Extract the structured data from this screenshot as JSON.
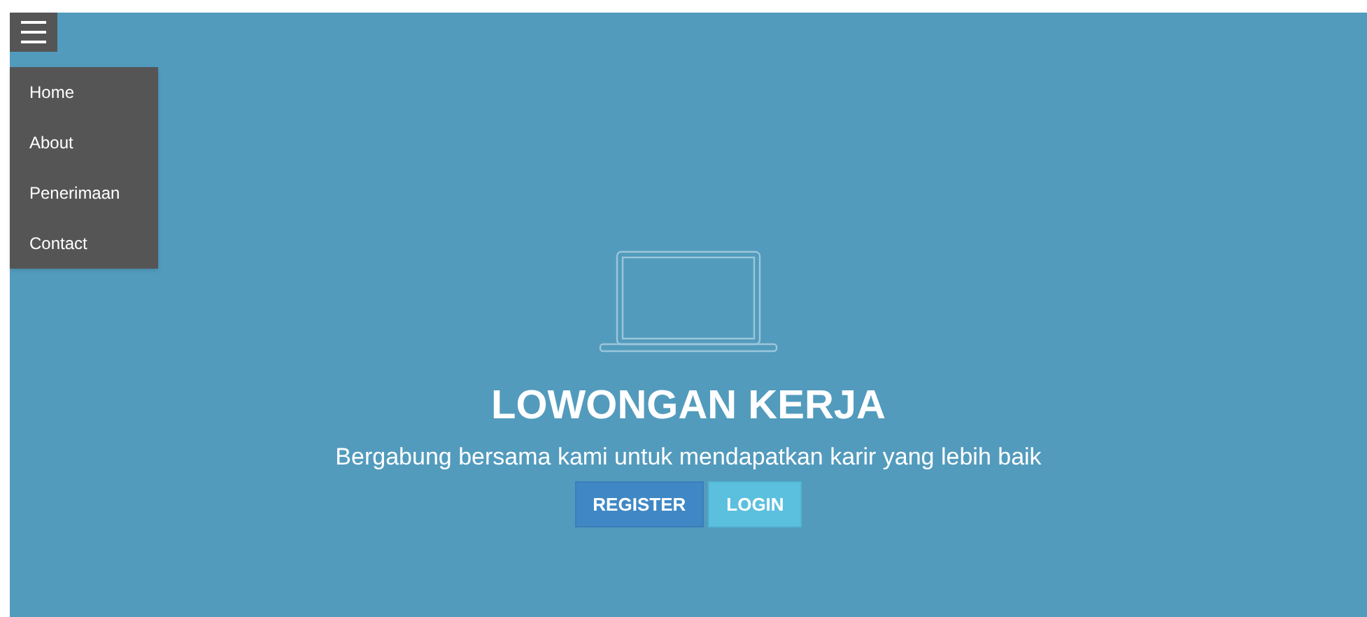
{
  "menu": {
    "expanded": true,
    "items": [
      {
        "label": "Home"
      },
      {
        "label": "About"
      },
      {
        "label": "Penerimaan"
      },
      {
        "label": "Contact"
      }
    ]
  },
  "hero": {
    "title": "LOWONGAN KERJA",
    "subtitle": "Bergabung bersama kami untuk mendapatkan karir yang lebih baik"
  },
  "buttons": [
    {
      "label": "REGISTER",
      "kind": "primary"
    },
    {
      "label": "LOGIN",
      "kind": "secondary"
    }
  ]
}
